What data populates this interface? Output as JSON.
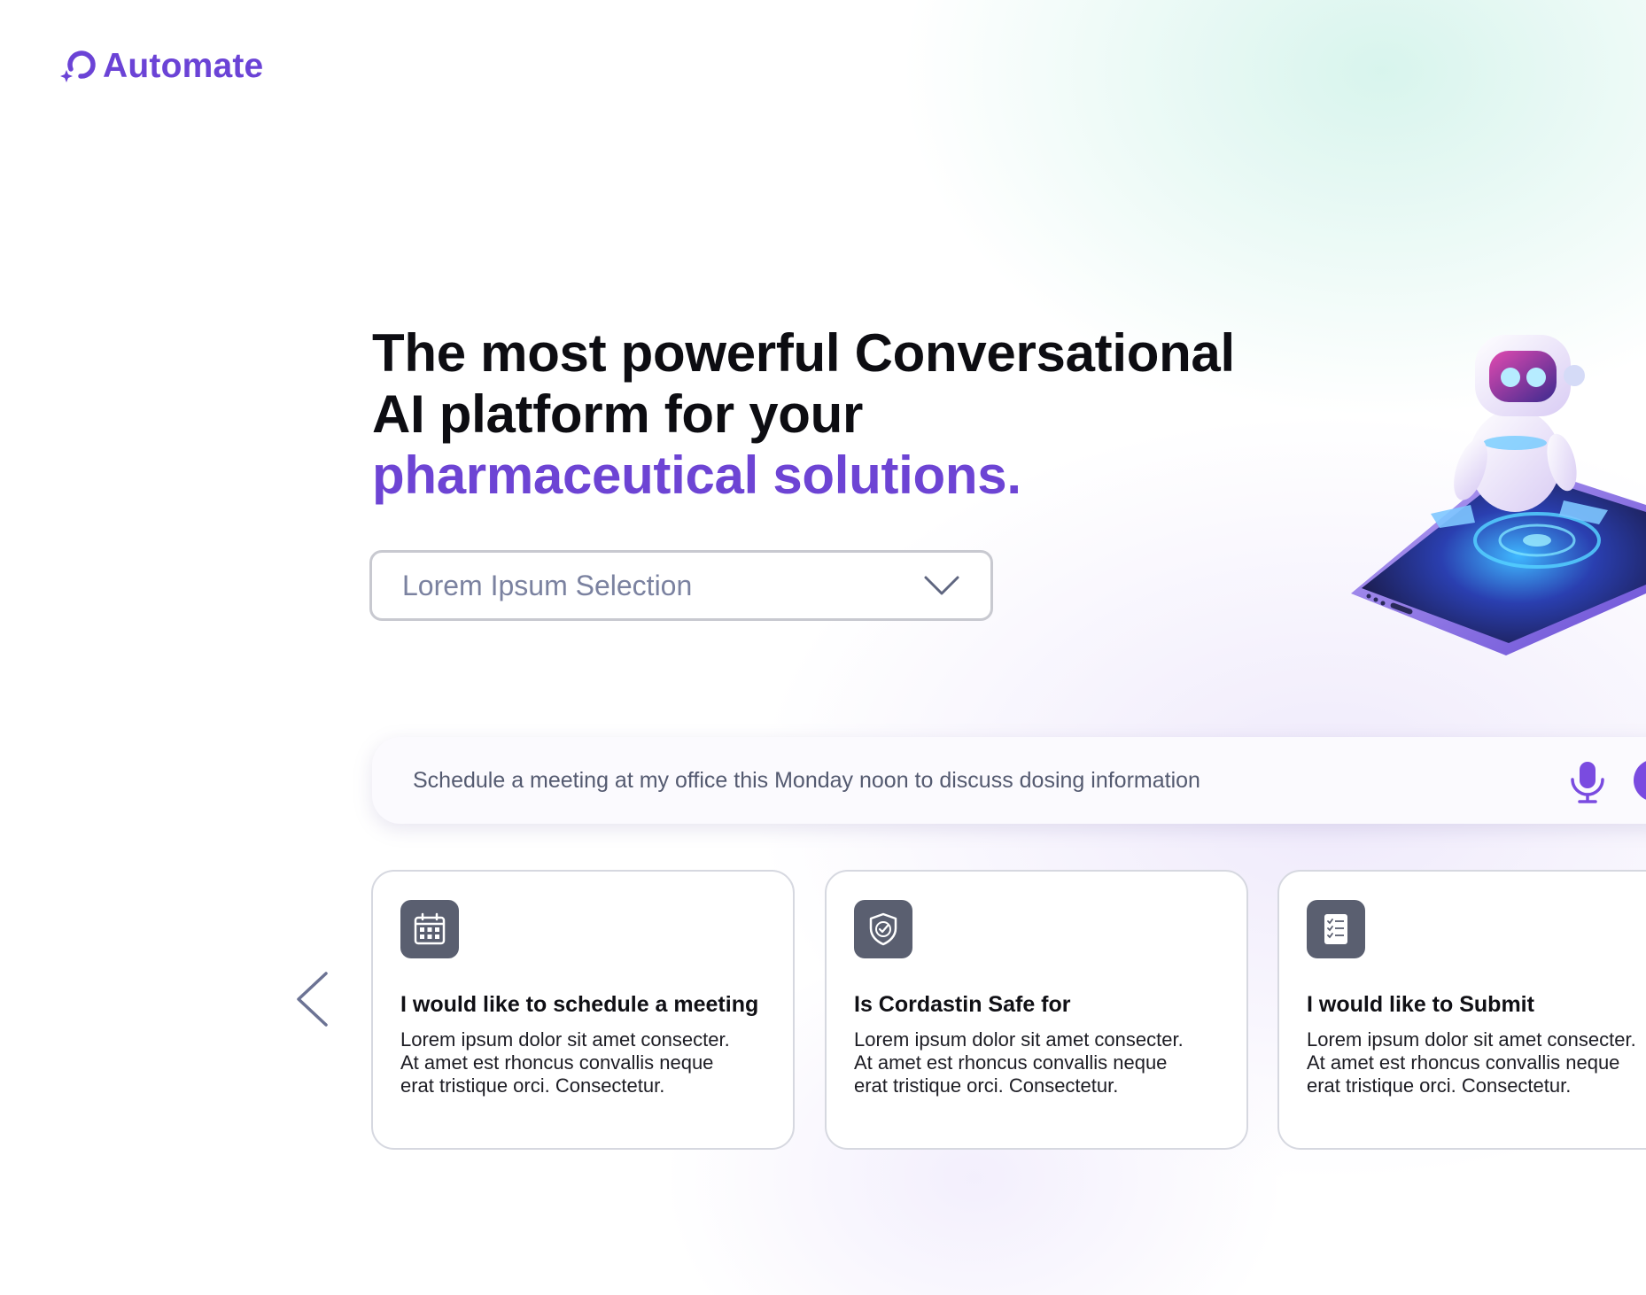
{
  "brand": {
    "name": "Automate",
    "icon": "loop-sparkle-icon",
    "color": "#6b43d6"
  },
  "hero": {
    "line1": "The most powerful Conversational",
    "line2": "AI platform for your",
    "line3": "pharmaceutical solutions.",
    "accent_color": "#6d44d4"
  },
  "selection": {
    "value": "Lorem Ipsum Selection",
    "icon": "chevron-down-icon"
  },
  "prompt": {
    "value": "Schedule a meeting at my office this Monday noon to discuss dosing information",
    "mic_icon": "microphone-icon",
    "send_color": "#7a4be0"
  },
  "carousel": {
    "prev_icon": "chevron-left-icon",
    "cards": [
      {
        "icon": "calendar-icon",
        "title": "I would like to schedule a meeting",
        "body": "Lorem ipsum dolor sit amet consecter.\nAt amet est rhoncus convallis neque\nerat tristique orci. Consectetur."
      },
      {
        "icon": "shield-check-icon",
        "title": "Is Cordastin Safe for",
        "body": "Lorem ipsum dolor sit amet consecter.\nAt amet est rhoncus convallis neque\nerat tristique orci. Consectetur."
      },
      {
        "icon": "checklist-icon",
        "title": "I would like to Submit",
        "body": "Lorem ipsum dolor sit amet consecter.\nAt amet est rhoncus convallis neque\nerat tristique orci. Consectetur."
      }
    ]
  },
  "illustration": {
    "icon": "robot-on-phone-illustration"
  }
}
